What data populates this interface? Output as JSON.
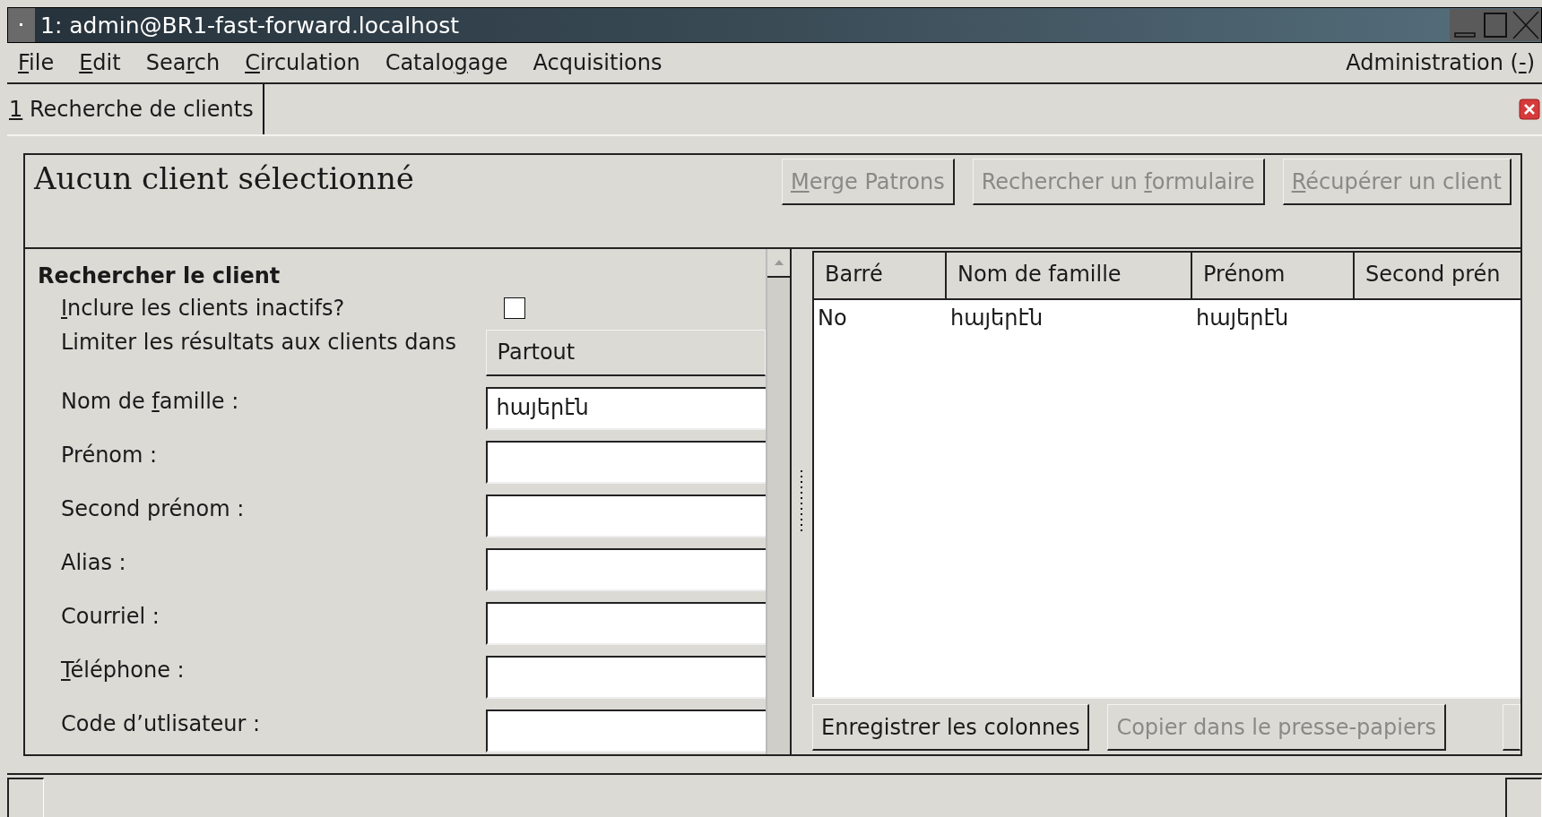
{
  "window": {
    "title": "1: admin@BR1-fast-forward.localhost"
  },
  "menu_bar": {
    "items": [
      {
        "label_parts": {
          "key": "F",
          "after": "ile"
        }
      },
      {
        "label_parts": {
          "key": "E",
          "after": "dit"
        }
      },
      {
        "label_parts": {
          "before": "Sea",
          "key": "r",
          "after": "ch"
        }
      },
      {
        "label_parts": {
          "key": "C",
          "after": "irculation"
        }
      },
      {
        "label_parts": {
          "before": "Catalo",
          "key": "g",
          "after": "age"
        }
      },
      {
        "label": "Acquisitions"
      }
    ],
    "right_item": {
      "label_parts": {
        "before": "Administration (",
        "key": "-",
        "after": ")"
      }
    }
  },
  "tabs": [
    {
      "label_parts": {
        "key": "1",
        "after": " Recherche de clients"
      },
      "selected": true
    }
  ],
  "patron_header": {
    "title": "Aucun client sélectionné",
    "buttons": [
      {
        "label_parts": {
          "key": "M",
          "after": "erge Patrons"
        },
        "disabled": true
      },
      {
        "label_parts": {
          "before": "Rechercher un ",
          "key": "f",
          "after": "ormulaire"
        },
        "disabled": true
      },
      {
        "label_parts": {
          "key": "R",
          "after": "écupérer un client"
        },
        "disabled": true
      }
    ]
  },
  "search_form": {
    "heading": "Rechercher le client",
    "fields": [
      {
        "kind": "checkbox",
        "label_parts": {
          "key": "I",
          "after": "nclure les clients inactifs?"
        },
        "checked": false
      },
      {
        "kind": "dropdown",
        "label": "Limiter les résultats aux clients dans",
        "value": "Partout"
      },
      {
        "kind": "text",
        "label_parts": {
          "before": "Nom de ",
          "key": "f",
          "after": "amille :"
        },
        "value": "հայերէն"
      },
      {
        "kind": "text",
        "label": "Prénom :"
      },
      {
        "kind": "text",
        "label": "Second prénom :"
      },
      {
        "kind": "text",
        "label": "Alias :"
      },
      {
        "kind": "text",
        "label": "Courriel :"
      },
      {
        "kind": "text",
        "label_parts": {
          "key": "T",
          "after": "éléphone :"
        }
      },
      {
        "kind": "text",
        "label": "Code d’utlisateur :"
      }
    ]
  },
  "results_table": {
    "columns": [
      "Barré",
      "Nom de famille",
      "Prénom",
      "Second prén"
    ],
    "rows": [
      {
        "cells": [
          "No",
          "հայերէն",
          "հայերէն"
        ]
      }
    ],
    "buttons": [
      {
        "label": "Enregistrer les colonnes",
        "disabled": false
      },
      {
        "label": "Copier dans le presse-papiers",
        "disabled": true
      }
    ]
  }
}
